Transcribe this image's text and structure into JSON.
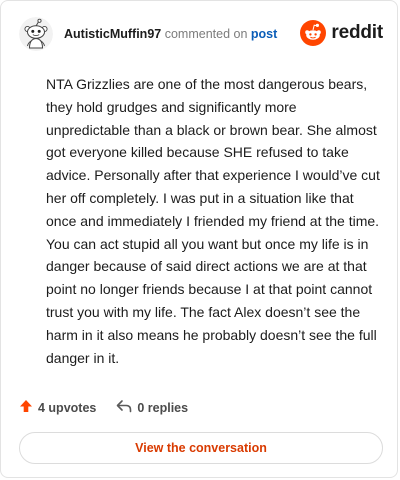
{
  "comment": {
    "username": "AutisticMuffin97",
    "action_text": "commented on",
    "post_link": "post",
    "body": "NTA Grizzlies are one of the most dangerous bears, they hold grudges and significantly more unpredictable than a black or brown bear. She almost got everyone killed because SHE refused to take advice. Personally after that experience I would’ve cut her off completely. I was put in a situation like that once and immediately I friended my friend at the time. You can act stupid all you want but once my life is in danger because of said direct actions we are at that point no longer friends because I at that point cannot trust you with my life. The fact Alex doesn’t see the harm in it also means he probably doesn’t see the full danger in it."
  },
  "brand": {
    "wordmark": "reddit",
    "icon": "reddit-snoo-icon",
    "color": "#ff4500"
  },
  "actions": {
    "upvotes": "4 upvotes",
    "replies": "0 replies",
    "upvote_icon": "upvote-arrow-icon",
    "reply_icon": "reply-arrow-icon",
    "upvote_color": "#ff4500"
  },
  "cta": {
    "label": "View the conversation",
    "color": "#d93a00"
  }
}
